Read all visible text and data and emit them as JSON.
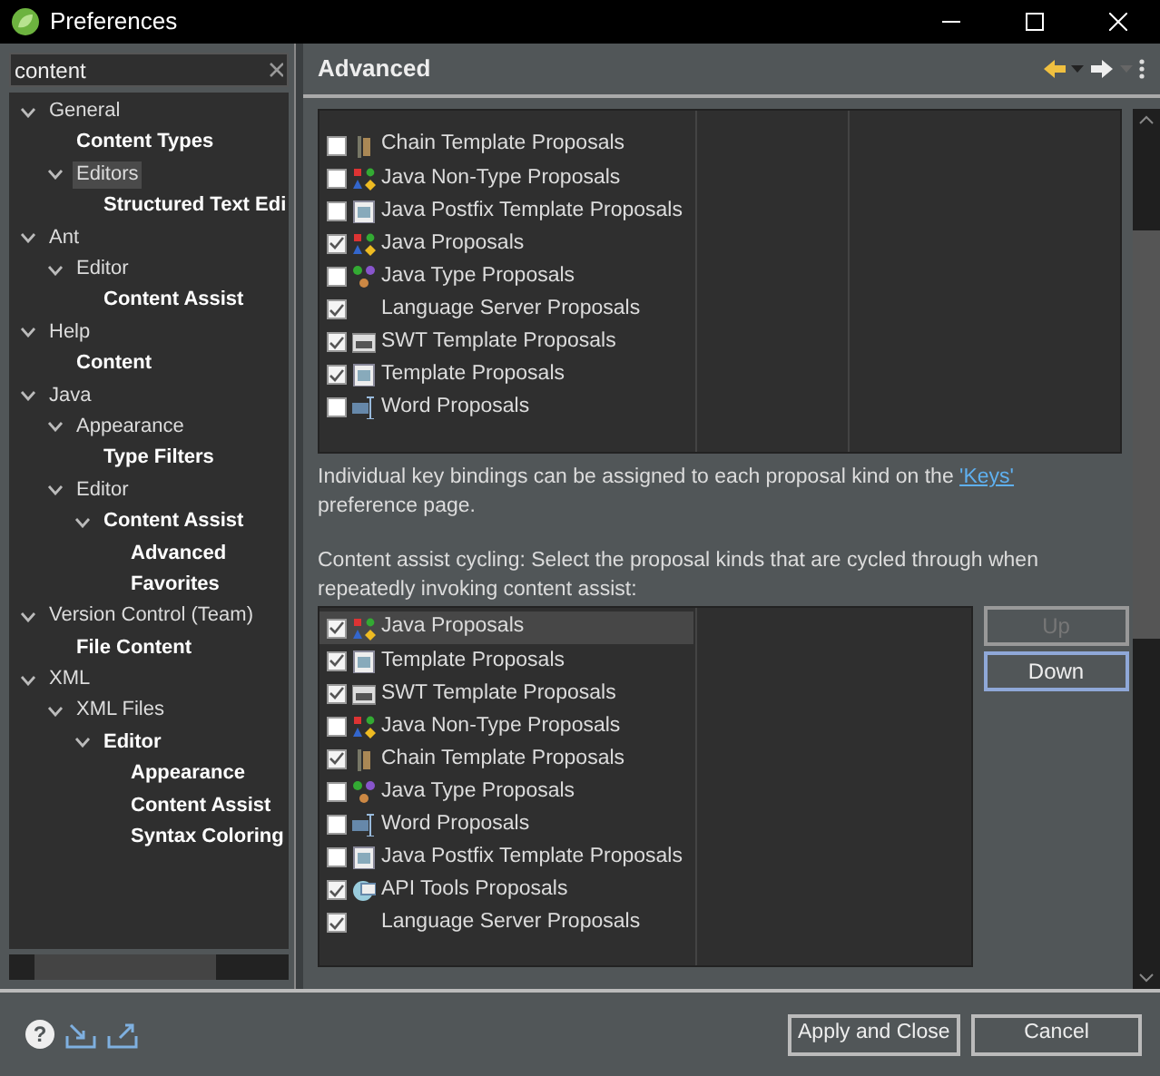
{
  "window": {
    "title": "Preferences"
  },
  "filter": {
    "value": "content"
  },
  "tree": [
    {
      "label": "General",
      "expanded": true,
      "matched": false,
      "selected": false,
      "children": [
        {
          "label": "Content Types",
          "matched": true,
          "selected": false
        },
        {
          "label": "Editors",
          "expanded": true,
          "matched": false,
          "selected": true,
          "children": [
            {
              "label": "Structured Text Edi",
              "matched": true,
              "selected": false
            }
          ]
        }
      ]
    },
    {
      "label": "Ant",
      "expanded": true,
      "matched": false,
      "selected": false,
      "children": [
        {
          "label": "Editor",
          "expanded": true,
          "matched": false,
          "selected": false,
          "children": [
            {
              "label": "Content Assist",
              "matched": true,
              "selected": false
            }
          ]
        }
      ]
    },
    {
      "label": "Help",
      "expanded": true,
      "matched": false,
      "selected": false,
      "children": [
        {
          "label": "Content",
          "matched": true,
          "selected": false
        }
      ]
    },
    {
      "label": "Java",
      "expanded": true,
      "matched": false,
      "selected": false,
      "children": [
        {
          "label": "Appearance",
          "expanded": true,
          "matched": false,
          "selected": false,
          "children": [
            {
              "label": "Type Filters",
              "matched": true,
              "selected": false
            }
          ]
        },
        {
          "label": "Editor",
          "expanded": true,
          "matched": false,
          "selected": false,
          "children": [
            {
              "label": "Content Assist",
              "expanded": true,
              "matched": true,
              "selected": false,
              "children": [
                {
                  "label": "Advanced",
                  "matched": true,
                  "selected": false
                },
                {
                  "label": "Favorites",
                  "matched": true,
                  "selected": false
                }
              ]
            }
          ]
        }
      ]
    },
    {
      "label": "Version Control (Team)",
      "expanded": true,
      "matched": false,
      "selected": false,
      "children": [
        {
          "label": "File Content",
          "matched": true,
          "selected": false
        }
      ]
    },
    {
      "label": "XML",
      "expanded": true,
      "matched": false,
      "selected": false,
      "children": [
        {
          "label": "XML Files",
          "expanded": true,
          "matched": false,
          "selected": false,
          "children": [
            {
              "label": "Editor",
              "expanded": true,
              "matched": true,
              "selected": false,
              "children": [
                {
                  "label": "Appearance",
                  "matched": true,
                  "selected": false
                },
                {
                  "label": "Content Assist",
                  "matched": true,
                  "selected": false
                },
                {
                  "label": "Syntax Coloring",
                  "matched": true,
                  "selected": false
                }
              ]
            }
          ]
        }
      ]
    }
  ],
  "page": {
    "title": "Advanced",
    "default_list": [
      {
        "label": "Chain Template Proposals",
        "kind": "chain",
        "checked": false
      },
      {
        "label": "Java Non-Type Proposals",
        "kind": "java",
        "checked": false
      },
      {
        "label": "Java Postfix Template Proposals",
        "kind": "template",
        "checked": false
      },
      {
        "label": "Java Proposals",
        "kind": "java",
        "checked": true
      },
      {
        "label": "Java Type Proposals",
        "kind": "type",
        "checked": false
      },
      {
        "label": "Language Server Proposals",
        "kind": "plain",
        "checked": true
      },
      {
        "label": "SWT Template Proposals",
        "kind": "swt",
        "checked": true
      },
      {
        "label": "Template Proposals",
        "kind": "template",
        "checked": true
      },
      {
        "label": "Word Proposals",
        "kind": "word",
        "checked": false
      }
    ],
    "note": "Individual key bindings can be assigned to each proposal kind on the",
    "note_link": "'Keys'",
    "note_end": "preference page.",
    "cycling_label": "Content assist cycling: Select the proposal kinds that are cycled through when repeatedly invoking content assist:",
    "cycling_list": [
      {
        "label": "Java Proposals",
        "kind": "java",
        "checked": true,
        "selected": true
      },
      {
        "label": "Template Proposals",
        "kind": "template",
        "checked": true,
        "selected": false
      },
      {
        "label": "SWT Template Proposals",
        "kind": "swt",
        "checked": true,
        "selected": false
      },
      {
        "label": "Java Non-Type Proposals",
        "kind": "java",
        "checked": false,
        "selected": false
      },
      {
        "label": "Chain Template Proposals",
        "kind": "chain",
        "checked": true,
        "selected": false
      },
      {
        "label": "Java Type Proposals",
        "kind": "type",
        "checked": false,
        "selected": false
      },
      {
        "label": "Word Proposals",
        "kind": "word",
        "checked": false,
        "selected": false
      },
      {
        "label": "Java Postfix Template Proposals",
        "kind": "template",
        "checked": false,
        "selected": false
      },
      {
        "label": "API Tools Proposals",
        "kind": "api",
        "checked": true,
        "selected": false
      },
      {
        "label": "Language Server Proposals",
        "kind": "plain",
        "checked": true,
        "selected": false
      }
    ],
    "buttons": [
      {
        "label": "Up",
        "disabled": true,
        "focused": false
      },
      {
        "label": "Down",
        "disabled": false,
        "focused": true
      }
    ]
  },
  "help_glyph": "?",
  "footer_buttons": [
    {
      "label": "Apply and Close"
    },
    {
      "label": "Cancel"
    }
  ]
}
